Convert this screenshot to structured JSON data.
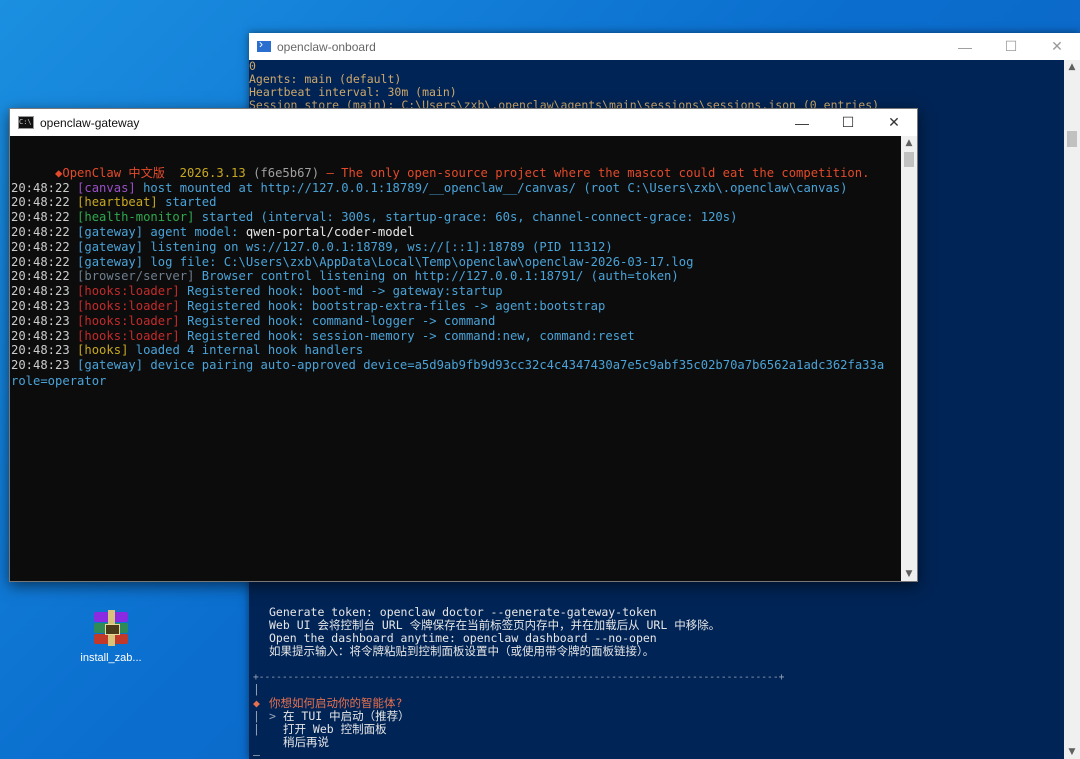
{
  "desktop": {
    "icon_label": "install_zab..."
  },
  "back_window": {
    "title": "openclaw-onboard",
    "controls": {
      "minimize": "—",
      "maximize": "☐",
      "close": "✕"
    },
    "top_lines": [
      "0",
      "Agents: main (default)",
      "Heartbeat interval: 30m (main)",
      "Session store (main): C:\\Users\\zxb\\.openclaw\\agents\\main\\sessions\\sessions.json (0 entries)"
    ],
    "bottom_lines": {
      "token": "Generate token: openclaw doctor --generate-gateway-token",
      "webui": "Web UI 会将控制台 URL 令牌保存在当前标签页内存中，并在加载后从 URL 中移除。",
      "open": "Open the dashboard anytime: openclaw dashboard --no-open",
      "hint": "如果提示输入：将令牌粘贴到控制面板设置中（或使用带令牌的面板链接）。",
      "separator": "+------------------------------------------------------------------------------------------+",
      "question": "你想如何启动你的智能体?",
      "options": [
        "在 TUI 中启动（推荐）",
        "打开 Web 控制面板",
        "稍后再说"
      ],
      "selected_marker": ">",
      "left_gutter": [
        "|",
        "◆",
        "|",
        "|",
        "—"
      ]
    }
  },
  "front_window": {
    "title": "openclaw-gateway",
    "icon_text": "C:\\",
    "controls": {
      "minimize": "—",
      "maximize": "☐",
      "close": "✕"
    },
    "banner": {
      "product": "OpenClaw 中文版",
      "version": "2026.3.13",
      "hash": "(f6e5b67)",
      "tagline": "— The only open-source project where the mascot could eat the competition."
    },
    "log": [
      {
        "time": "20:48:22",
        "tag": "[canvas]",
        "tag_color": "#9b4fc8",
        "msg": "host mounted at http://127.0.0.1:18789/__openclaw__/canvas/ (root C:\\Users\\zxb\\.openclaw\\canvas)",
        "msg_color": "#4aa3d8"
      },
      {
        "time": "20:48:22",
        "tag": "[heartbeat]",
        "tag_color": "#c8a820",
        "msg": "started",
        "msg_color": "#4aa3d8"
      },
      {
        "time": "20:48:22",
        "tag": "[health-monitor]",
        "tag_color": "#2fa84e",
        "msg": "started (interval: 300s, startup-grace: 60s, channel-connect-grace: 120s)",
        "msg_color": "#4aa3d8"
      },
      {
        "time": "20:48:22",
        "tag": "[gateway]",
        "tag_color": "#4aa3d8",
        "msg": "agent model: ",
        "msg_color": "#4aa3d8",
        "extra": "qwen-portal/coder-model",
        "extra_color": "#e8e8e8"
      },
      {
        "time": "20:48:22",
        "tag": "[gateway]",
        "tag_color": "#4aa3d8",
        "msg": "listening on ws://127.0.0.1:18789, ws://[::1]:18789 (PID 11312)",
        "msg_color": "#4aa3d8"
      },
      {
        "time": "20:48:22",
        "tag": "[gateway]",
        "tag_color": "#4aa3d8",
        "msg": "log file: C:\\Users\\zxb\\AppData\\Local\\Temp\\openclaw\\openclaw-2026-03-17.log",
        "msg_color": "#4aa3d8"
      },
      {
        "time": "20:48:22",
        "tag": "[browser/server]",
        "tag_color": "#6f7f8f",
        "msg": "Browser control listening on http://127.0.0.1:18791/ (auth=token)",
        "msg_color": "#4aa3d8"
      },
      {
        "time": "20:48:23",
        "tag": "[hooks:loader]",
        "tag_color": "#c42b2b",
        "msg": "Registered hook: boot-md -> gateway:startup",
        "msg_color": "#4aa3d8"
      },
      {
        "time": "20:48:23",
        "tag": "[hooks:loader]",
        "tag_color": "#c42b2b",
        "msg": "Registered hook: bootstrap-extra-files -> agent:bootstrap",
        "msg_color": "#4aa3d8"
      },
      {
        "time": "20:48:23",
        "tag": "[hooks:loader]",
        "tag_color": "#c42b2b",
        "msg": "Registered hook: command-logger -> command",
        "msg_color": "#4aa3d8"
      },
      {
        "time": "20:48:23",
        "tag": "[hooks:loader]",
        "tag_color": "#c42b2b",
        "msg": "Registered hook: session-memory -> command:new, command:reset",
        "msg_color": "#4aa3d8"
      },
      {
        "time": "20:48:23",
        "tag": "[hooks]",
        "tag_color": "#c8a820",
        "msg": "loaded 4 internal hook handlers",
        "msg_color": "#4aa3d8"
      },
      {
        "time": "20:48:23",
        "tag": "[gateway]",
        "tag_color": "#4aa3d8",
        "msg": "device pairing auto-approved device=a5d9ab9fb9d93cc32c4c4347430a7e5c9abf35c02b70a7b6562a1adc362fa33a",
        "msg_color": "#4aa3d8"
      }
    ],
    "wrap_line": "role=operator"
  }
}
